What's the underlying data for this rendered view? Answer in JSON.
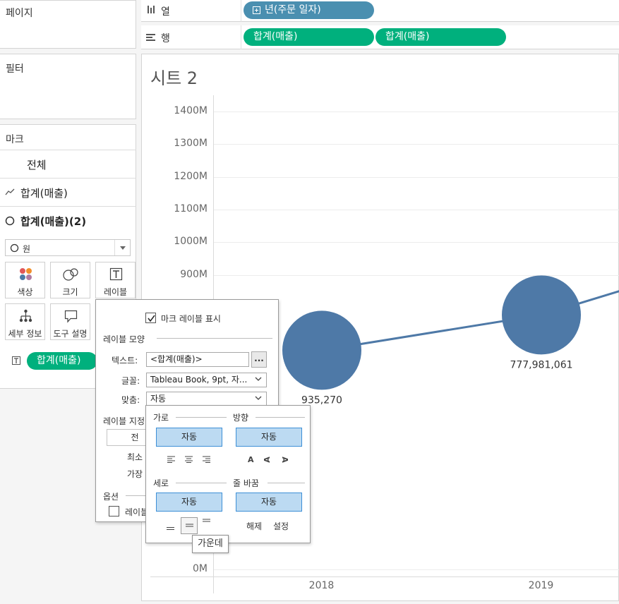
{
  "shelves": {
    "pages_label": "페이지",
    "columns_label": "열",
    "rows_label": "행",
    "filters_label": "필터",
    "columns_pill": "년(주문 일자)",
    "rows_pills": [
      "합계(매출)",
      "합계(매출)"
    ]
  },
  "marks": {
    "title": "마크",
    "all": "전체",
    "sum_sales": "합계(매출)",
    "sum_sales_2": "합계(매출)(2)",
    "mark_type": "원",
    "cards": {
      "color": "색상",
      "size": "크기",
      "label": "레이블",
      "detail": "세부 정보",
      "tooltip": "도구 설명"
    },
    "label_pill": "합계(매출)"
  },
  "sheet": {
    "title": "시트 2"
  },
  "label_dialog": {
    "show_labels": "마크 레이블 표시",
    "appearance": "레이블 모양",
    "text_label": "텍스트:",
    "text_value": "<합계(매출)>",
    "ellipsis": "...",
    "font_label": "글꼴:",
    "font_value": "Tableau Book, 9pt, 자...",
    "align_label": "맞춤:",
    "align_value": "자동",
    "marks_to_label": "레이블 지정",
    "marks_to_label_btn": "전",
    "min_label": "최소",
    "most_label": "가장",
    "options": "옵션",
    "option_cb": "레이블"
  },
  "align_popup": {
    "horizontal": "가로",
    "direction": "방향",
    "auto_h": "자동",
    "auto_dir": "자동",
    "vertical": "세로",
    "wrap": "줄 바꿈",
    "auto_v": "자동",
    "auto_wrap": "자동",
    "dir_glyphs": [
      "A",
      "A",
      "A"
    ],
    "wrap_off": "해제",
    "wrap_on": "설정",
    "tooltip": "가운데"
  },
  "chart_data": {
    "type": "line",
    "title": "시트 2",
    "x": [
      "2018",
      "2019"
    ],
    "y_ticks": [
      "0M",
      "900M",
      "1000M",
      "1100M",
      "1200M",
      "1300M",
      "1400M"
    ],
    "ylim": [
      0,
      1450
    ],
    "series": [
      {
        "values": [
          670,
          778
        ],
        "point_labels": [
          "935,270",
          "777,981,061"
        ]
      }
    ],
    "colors": {
      "line": "#4e79a7"
    },
    "grid": true
  }
}
